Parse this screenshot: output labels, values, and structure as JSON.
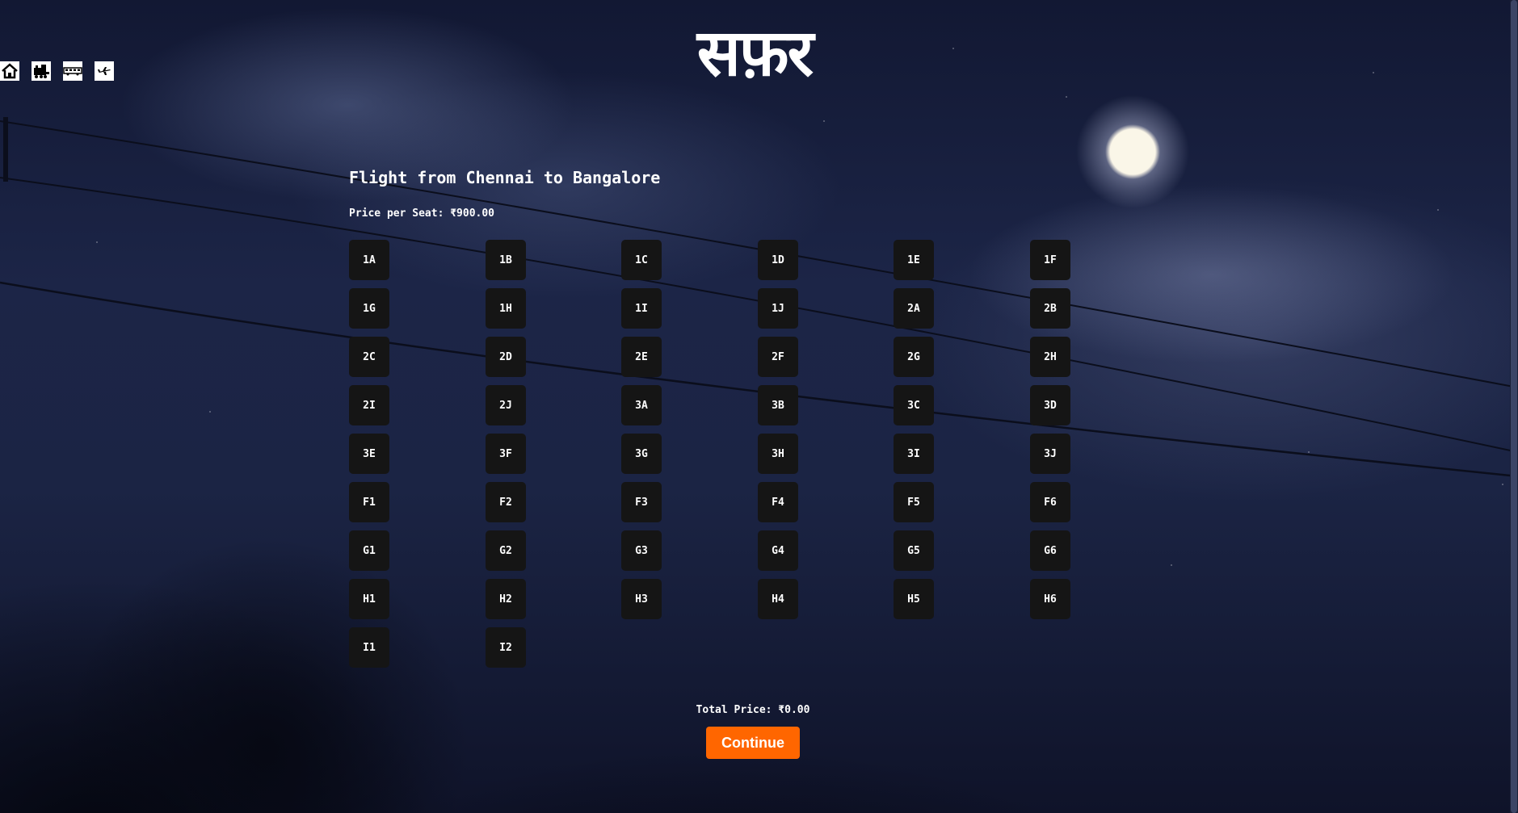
{
  "app": {
    "logo_text": "सफ़र"
  },
  "nav": [
    {
      "icon": "home-icon"
    },
    {
      "icon": "train-icon"
    },
    {
      "icon": "bus-icon"
    },
    {
      "icon": "flight-icon"
    }
  ],
  "booking": {
    "title": "Flight from Chennai to Bangalore",
    "price_per_seat": "Price per Seat: ₹900.00",
    "seats": [
      "1A",
      "1B",
      "1C",
      "1D",
      "1E",
      "1F",
      "1G",
      "1H",
      "1I",
      "1J",
      "2A",
      "2B",
      "2C",
      "2D",
      "2E",
      "2F",
      "2G",
      "2H",
      "2I",
      "2J",
      "3A",
      "3B",
      "3C",
      "3D",
      "3E",
      "3F",
      "3G",
      "3H",
      "3I",
      "3J",
      "F1",
      "F2",
      "F3",
      "F4",
      "F5",
      "F6",
      "G1",
      "G2",
      "G3",
      "G4",
      "G5",
      "G6",
      "H1",
      "H2",
      "H3",
      "H4",
      "H5",
      "H6",
      "I1",
      "I2"
    ],
    "total_price": "Total Price: ₹0.00",
    "continue_label": "Continue"
  },
  "colors": {
    "accent": "#ff6600",
    "seat_bg": "#151515"
  }
}
